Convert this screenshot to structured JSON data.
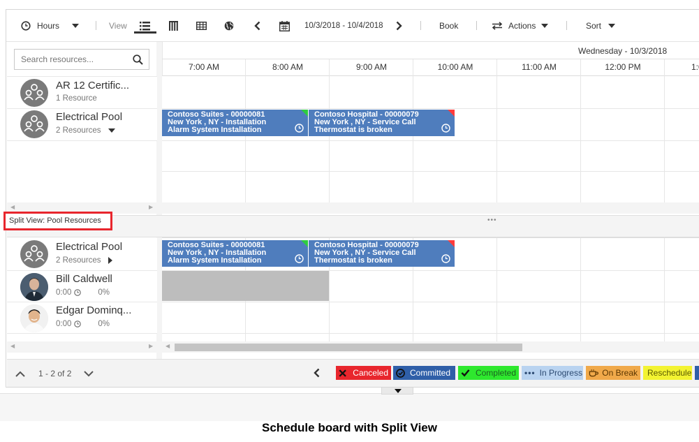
{
  "toolbar": {
    "hours_label": "Hours",
    "view_label": "View",
    "date_range": "10/3/2018 - 10/4/2018",
    "book_label": "Book",
    "actions_label": "Actions",
    "sort_label": "Sort"
  },
  "search": {
    "placeholder": "Search resources..."
  },
  "top_resources": [
    {
      "name": "AR 12 Certific...",
      "sub": "1 Resource"
    },
    {
      "name": "Electrical Pool",
      "sub": "2 Resources"
    }
  ],
  "split_view_label": "Split View: Pool Resources",
  "bottom_resources": [
    {
      "name": "Electrical Pool",
      "sub": "2 Resources"
    },
    {
      "name": "Bill Caldwell",
      "hours": "0:00",
      "pct": "0%"
    },
    {
      "name": "Edgar Dominq...",
      "hours": "0:00",
      "pct": "0%"
    }
  ],
  "date_header": "Wednesday - 10/3/2018",
  "time_headers": [
    "7:00 AM",
    "8:00 AM",
    "9:00 AM",
    "10:00 AM",
    "11:00 AM",
    "12:00 PM",
    "1:0"
  ],
  "bookings": [
    {
      "line1": "Contoso Suites - 00000081",
      "line2": "New York , NY - Installation",
      "line3": "Alarm System Installation",
      "corner_color": "#2ecc40"
    },
    {
      "line1": "Contoso Hospital - 00000079",
      "line2": "New York , NY - Service Call",
      "line3": "Thermostat is broken",
      "corner_color": "#ff3b3b"
    }
  ],
  "pager": {
    "text": "1 - 2 of 2"
  },
  "legend": [
    {
      "label": "Canceled",
      "bg": "#e8262d",
      "fg": "#ffffff",
      "icon": "x-icon"
    },
    {
      "label": "Committed",
      "bg": "#2f5fa8",
      "fg": "#ffffff",
      "icon": "committed-icon"
    },
    {
      "label": "Completed",
      "bg": "#2ee82e",
      "fg": "#1b5e20",
      "icon": "check-icon"
    },
    {
      "label": "In Progress",
      "bg": "#b9d3f0",
      "fg": "#2d4b73",
      "icon": "dots-icon"
    },
    {
      "label": "On Break",
      "bg": "#f0a94a",
      "fg": "#5a3500",
      "icon": "coffee-icon"
    },
    {
      "label": "Reschedule",
      "bg": "#f3f331",
      "fg": "#5a5a00",
      "icon": ""
    }
  ],
  "caption": "Schedule board with Split View"
}
